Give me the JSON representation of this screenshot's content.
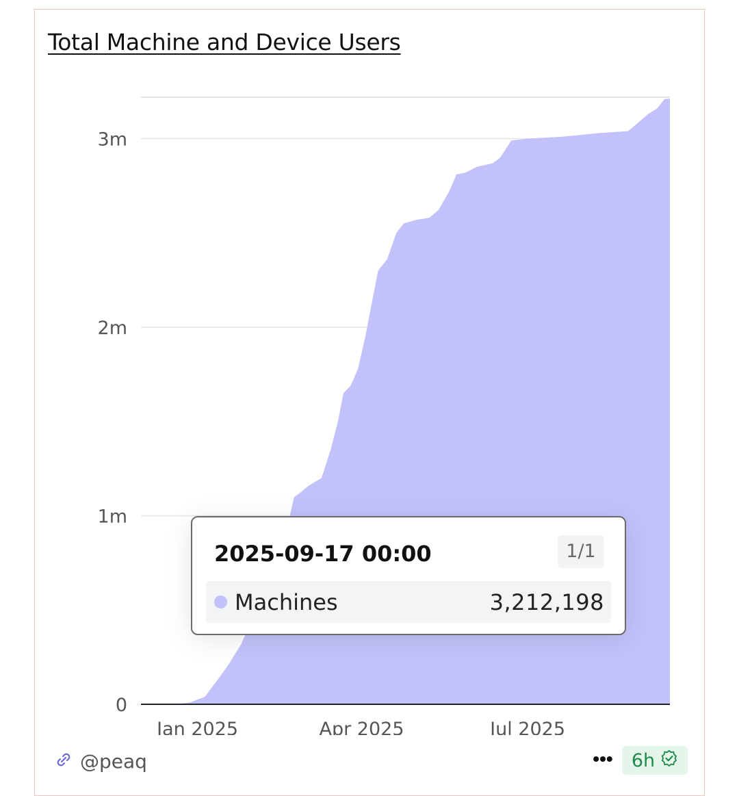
{
  "card": {
    "title": "Total Machine and Device Users"
  },
  "chart_data": {
    "type": "area",
    "title": "Total Machine and Device Users",
    "xlabel": "",
    "ylabel": "",
    "x_tick_labels": [
      "Jan 2025",
      "Apr 2025",
      "Jul 2025"
    ],
    "y_tick_labels": [
      "0",
      "1m",
      "2m",
      "3m"
    ],
    "ylim": [
      0,
      3220000
    ],
    "xlim": [
      "2024-12-01",
      "2025-09-17"
    ],
    "grid": "horizontal",
    "legend": "none",
    "color": "#c2c1fa",
    "series": [
      {
        "name": "Machines",
        "points": [
          [
            "2024-12-01",
            0
          ],
          [
            "2024-12-20",
            0
          ],
          [
            "2024-12-28",
            10000
          ],
          [
            "2025-01-05",
            40000
          ],
          [
            "2025-01-12",
            130000
          ],
          [
            "2025-01-18",
            210000
          ],
          [
            "2025-01-25",
            320000
          ],
          [
            "2025-02-01",
            480000
          ],
          [
            "2025-02-07",
            600000
          ],
          [
            "2025-02-12",
            720000
          ],
          [
            "2025-02-16",
            830000
          ],
          [
            "2025-02-20",
            970000
          ],
          [
            "2025-02-23",
            1100000
          ],
          [
            "2025-02-26",
            1120000
          ],
          [
            "2025-03-03",
            1160000
          ],
          [
            "2025-03-10",
            1200000
          ],
          [
            "2025-03-15",
            1350000
          ],
          [
            "2025-03-19",
            1500000
          ],
          [
            "2025-03-22",
            1650000
          ],
          [
            "2025-03-26",
            1690000
          ],
          [
            "2025-03-30",
            1780000
          ],
          [
            "2025-04-03",
            1950000
          ],
          [
            "2025-04-08",
            2200000
          ],
          [
            "2025-04-10",
            2300000
          ],
          [
            "2025-04-15",
            2360000
          ],
          [
            "2025-04-20",
            2500000
          ],
          [
            "2025-04-24",
            2550000
          ],
          [
            "2025-05-01",
            2570000
          ],
          [
            "2025-05-08",
            2580000
          ],
          [
            "2025-05-13",
            2620000
          ],
          [
            "2025-05-19",
            2720000
          ],
          [
            "2025-05-23",
            2810000
          ],
          [
            "2025-05-28",
            2820000
          ],
          [
            "2025-06-03",
            2850000
          ],
          [
            "2025-06-12",
            2870000
          ],
          [
            "2025-06-16",
            2900000
          ],
          [
            "2025-06-22",
            2990000
          ],
          [
            "2025-07-01",
            3000000
          ],
          [
            "2025-07-20",
            3010000
          ],
          [
            "2025-08-10",
            3030000
          ],
          [
            "2025-08-25",
            3040000
          ],
          [
            "2025-08-30",
            3080000
          ],
          [
            "2025-09-05",
            3130000
          ],
          [
            "2025-09-10",
            3160000
          ],
          [
            "2025-09-14",
            3210000
          ],
          [
            "2025-09-17",
            3212198
          ]
        ]
      }
    ],
    "tooltip": {
      "date": "2025-09-17 00:00",
      "page": "1/1",
      "series_name": "Machines",
      "value": "3,212,198",
      "dot_color": "#c2c1fa"
    }
  },
  "footer": {
    "author_icon": "link-icon",
    "author": "@peaq",
    "more_icon": "more-horizontal-icon",
    "more_glyph": "•••",
    "refresh": "6h",
    "refresh_icon": "verified-check-icon"
  }
}
